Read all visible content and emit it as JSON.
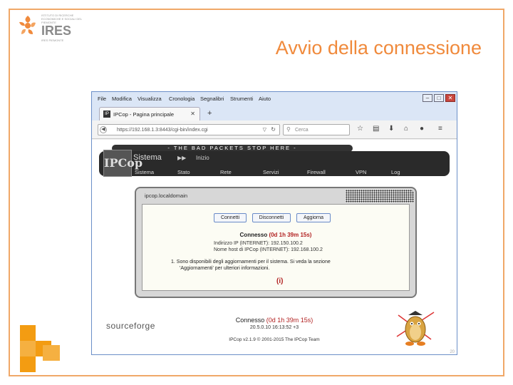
{
  "brand": {
    "name": "IRES",
    "small_lines": "ISTITUTO DI RICERCHE ECONOMICHE E SOCIALI DEL PIEMONTE",
    "sub": "IRES PIEMONTE"
  },
  "slide": {
    "title": "Avvio della connessione"
  },
  "browser": {
    "menu": [
      "File",
      "Modifica",
      "Visualizza",
      "Cronologia",
      "Segnalibri",
      "Strumenti",
      "Aiuto"
    ],
    "controls": {
      "minimize": "–",
      "maximize": "□",
      "close": "✕"
    },
    "tab": {
      "title": "IPCop - Pagina principale",
      "favicon": "IP",
      "close": "✕"
    },
    "new_tab": "+",
    "url": "https://192.168.1.3:8443/cgi-bin/index.cgi",
    "search_placeholder": "Cerca",
    "toolbar_icons": [
      "star-icon",
      "clipboard-icon",
      "download-icon",
      "home-icon",
      "chat-icon",
      "menu-icon"
    ]
  },
  "ipcop": {
    "band": "- THE BAD PACKETS STOP HERE -",
    "logo": "IPCop",
    "section": "Sistema",
    "arrow": "▶▶",
    "home": "Inizio",
    "nav": [
      "Sistema",
      "Stato",
      "Rete",
      "Servizi",
      "Firewall",
      "VPN",
      "Log"
    ],
    "panel_title": "ipcop.localdomain",
    "buttons": {
      "connect": "Connetti",
      "disconnect": "Disconnetti",
      "refresh": "Aggiorna"
    },
    "status_prefix": "Connesso",
    "status_duration": "(0d 1h 39m 15s)",
    "info_lines": [
      "Indirizzo IP (INTERNET): 192.150.100.2",
      "Nome host di IPCop (INTERNET): 192.168.100.2"
    ],
    "notice_lines": [
      "1.  Sono disponibili degli aggiornamenti per il sistema. Si veda la sezione",
      "'Aggiornamenti' per ulteriori informazioni."
    ],
    "info_icon": "(i)",
    "sourceforge": "sourceforge",
    "footer_status_prefix": "Connesso",
    "footer_status_duration": "(0d 1h 39m 15s)",
    "footer_ip": "20.5.0.10 16:13:52 +3",
    "footer_copy": "IPCop v2.1.9 © 2001-2015 The IPCop Team",
    "page_number": "20"
  },
  "colors": {
    "accent": "#f08a3c",
    "frame": "#f0a868",
    "status_red": "#b22222"
  }
}
